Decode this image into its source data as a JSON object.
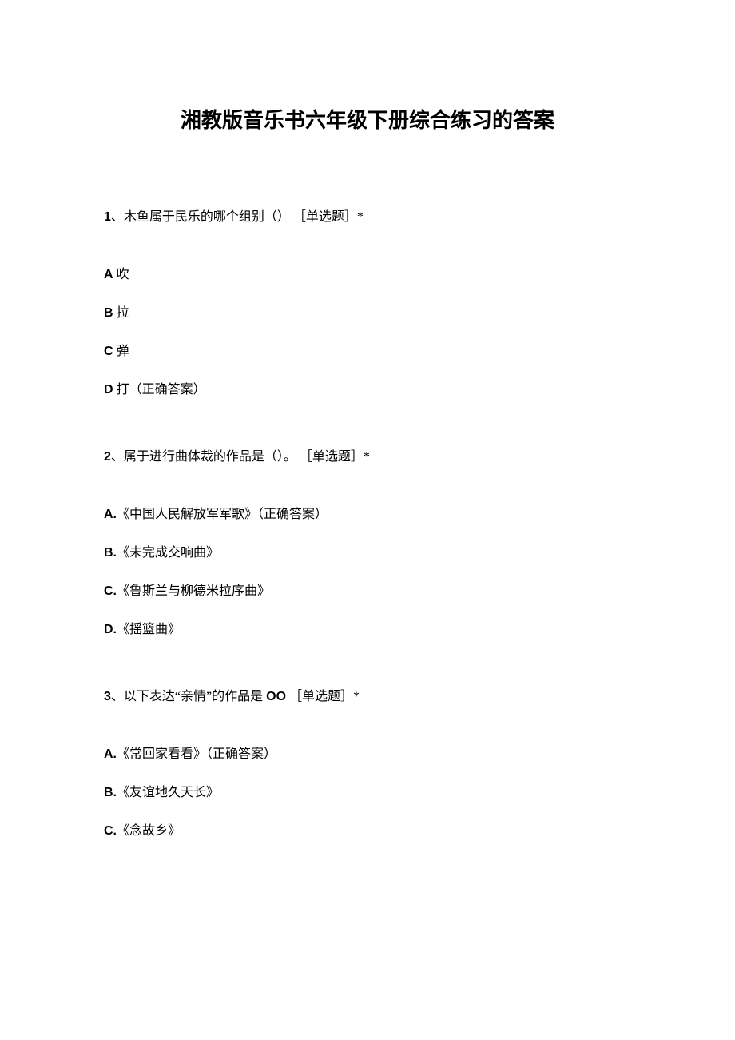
{
  "title": "湘教版音乐书六年级下册综合练习的答案",
  "questions": [
    {
      "num": "1",
      "stem_pre": "、木鱼属于民乐的哪个组别（）",
      "tag": "［单选题］*",
      "options": [
        {
          "letter": "A",
          "text": " 吹",
          "correct": ""
        },
        {
          "letter": "B",
          "text": " 拉",
          "correct": ""
        },
        {
          "letter": "C",
          "text": " 弹",
          "correct": ""
        },
        {
          "letter": "D",
          "text": " 打（正确答案）",
          "correct": ""
        }
      ]
    },
    {
      "num": "2",
      "stem_pre": "、属于进行曲体裁的作品是（）。",
      "tag": "［单选题］*",
      "options": [
        {
          "letter": "A.",
          "text": "《中国人民解放军军歌》（正确答案）",
          "correct": ""
        },
        {
          "letter": "B.",
          "text": "《未完成交响曲》",
          "correct": ""
        },
        {
          "letter": "C.",
          "text": "《鲁斯兰与柳德米拉序曲》",
          "correct": ""
        },
        {
          "letter": "D.",
          "text": "《摇篮曲》",
          "correct": ""
        }
      ]
    },
    {
      "num": "3",
      "stem_pre_a": "、以下表达“亲情”的作品是 ",
      "oo": "OO",
      "tag": "［单选题］*",
      "options": [
        {
          "letter": "A.",
          "text": "《常回家看看》（正确答案）",
          "correct": ""
        },
        {
          "letter": "B.",
          "text": "《友谊地久天长》",
          "correct": ""
        },
        {
          "letter": "C.",
          "text": "《念故乡》",
          "correct": ""
        }
      ]
    }
  ]
}
